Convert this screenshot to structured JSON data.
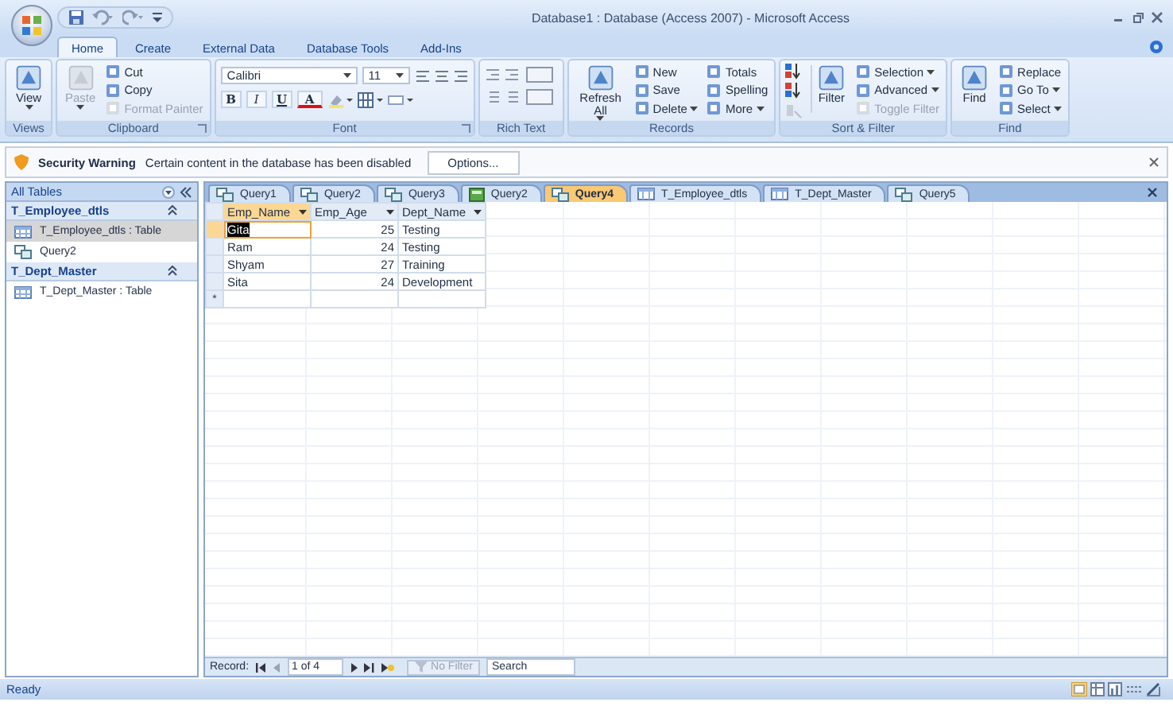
{
  "window": {
    "title": "Database1 : Database (Access 2007) - Microsoft Access"
  },
  "ribbon_tabs": [
    {
      "label": "Home",
      "selected": true
    },
    {
      "label": "Create",
      "selected": false
    },
    {
      "label": "External Data",
      "selected": false
    },
    {
      "label": "Database Tools",
      "selected": false
    },
    {
      "label": "Add-Ins",
      "selected": false
    }
  ],
  "ribbon_groups": [
    {
      "label": "Views",
      "kind": "commands",
      "launcher": false,
      "sort_buttons": false,
      "columns": [
        [
          {
            "label": "View",
            "kind": "large",
            "dropdown": true,
            "disabled": false
          }
        ]
      ]
    },
    {
      "label": "Clipboard",
      "kind": "commands",
      "launcher": true,
      "sort_buttons": false,
      "columns": [
        [
          {
            "label": "Paste",
            "kind": "large",
            "dropdown": true,
            "disabled": true
          }
        ],
        [
          {
            "label": "Cut",
            "kind": "small",
            "dropdown": false,
            "disabled": false
          },
          {
            "label": "Copy",
            "kind": "small",
            "dropdown": false,
            "disabled": false
          },
          {
            "label": "Format Painter",
            "kind": "small",
            "dropdown": false,
            "disabled": true
          }
        ]
      ]
    },
    {
      "label": "Font",
      "kind": "font",
      "launcher": true,
      "font": "Calibri",
      "size": "11",
      "format_buttons": [
        "B",
        "I",
        "U"
      ],
      "font_color": "A"
    },
    {
      "label": "Rich Text",
      "kind": "icons",
      "launcher": false
    },
    {
      "label": "Records",
      "kind": "commands",
      "launcher": false,
      "sort_buttons": false,
      "columns": [
        [
          {
            "label": "Refresh All",
            "kind": "large",
            "dropdown": true,
            "disabled": false
          }
        ],
        [
          {
            "label": "New",
            "kind": "small",
            "dropdown": false,
            "disabled": false
          },
          {
            "label": "Save",
            "kind": "small",
            "dropdown": false,
            "disabled": false
          },
          {
            "label": "Delete",
            "kind": "small",
            "dropdown": true,
            "disabled": false
          }
        ],
        [
          {
            "label": "Totals",
            "kind": "small",
            "dropdown": false,
            "disabled": false
          },
          {
            "label": "Spelling",
            "kind": "small",
            "dropdown": false,
            "disabled": false
          },
          {
            "label": "More",
            "kind": "small",
            "dropdown": true,
            "disabled": false
          }
        ]
      ]
    },
    {
      "label": "Sort & Filter",
      "kind": "commands",
      "launcher": false,
      "sort_buttons": true,
      "columns": [
        [
          {
            "label": "Filter",
            "kind": "large",
            "dropdown": false,
            "disabled": false
          }
        ],
        [
          {
            "label": "Selection",
            "kind": "small",
            "dropdown": true,
            "disabled": false
          },
          {
            "label": "Advanced",
            "kind": "small",
            "dropdown": true,
            "disabled": false
          },
          {
            "label": "Toggle Filter",
            "kind": "small",
            "dropdown": false,
            "disabled": true
          }
        ]
      ]
    },
    {
      "label": "Find",
      "kind": "commands",
      "launcher": false,
      "sort_buttons": false,
      "columns": [
        [
          {
            "label": "Find",
            "kind": "large",
            "dropdown": false,
            "disabled": false
          }
        ],
        [
          {
            "label": "Replace",
            "kind": "small",
            "dropdown": false,
            "disabled": false
          },
          {
            "label": "Go To",
            "kind": "small",
            "dropdown": true,
            "disabled": false
          },
          {
            "label": "Select",
            "kind": "small",
            "dropdown": true,
            "disabled": false
          }
        ]
      ]
    }
  ],
  "security_bar": {
    "title": "Security Warning",
    "message": "Certain content in the database has been disabled",
    "button": "Options..."
  },
  "navigation": {
    "header": "All Tables",
    "groups": [
      {
        "label": "T_Employee_dtls",
        "expanded": true,
        "items": [
          {
            "label": "T_Employee_dtls : Table",
            "kind": "table",
            "selected": true
          },
          {
            "label": "Query2",
            "kind": "query",
            "selected": false
          }
        ]
      },
      {
        "label": "T_Dept_Master",
        "expanded": true,
        "items": [
          {
            "label": "T_Dept_Master : Table",
            "kind": "table",
            "selected": false
          }
        ]
      }
    ]
  },
  "document_tabs": [
    {
      "label": "Query1",
      "kind": "query",
      "selected": false
    },
    {
      "label": "Query2",
      "kind": "query",
      "selected": false
    },
    {
      "label": "Query3",
      "kind": "query",
      "selected": false
    },
    {
      "label": "Query2",
      "kind": "form",
      "selected": false
    },
    {
      "label": "Query4",
      "kind": "query",
      "selected": true
    },
    {
      "label": "T_Employee_dtls",
      "kind": "table",
      "selected": false
    },
    {
      "label": "T_Dept_Master",
      "kind": "table",
      "selected": false
    },
    {
      "label": "Query5",
      "kind": "query",
      "selected": false
    }
  ],
  "datasheet": {
    "columns": [
      {
        "label": "Emp_Name",
        "kind": "text",
        "selected": true
      },
      {
        "label": "Emp_Age",
        "kind": "number",
        "selected": false
      },
      {
        "label": "Dept_Name",
        "kind": "text",
        "selected": false
      }
    ],
    "rows": [
      {
        "cells": [
          "Gita",
          "25",
          "Testing"
        ],
        "selected": true
      },
      {
        "cells": [
          "Ram",
          "24",
          "Testing"
        ],
        "selected": false
      },
      {
        "cells": [
          "Shyam",
          "27",
          "Training"
        ],
        "selected": false
      },
      {
        "cells": [
          "Sita",
          "24",
          "Development"
        ],
        "selected": false
      }
    ],
    "new_row_marker": "*"
  },
  "record_nav": {
    "label": "Record:",
    "position": "1 of 4",
    "filter": "No Filter",
    "filter_active": false,
    "search_placeholder": "Search"
  },
  "status_bar": {
    "text": "Ready"
  }
}
